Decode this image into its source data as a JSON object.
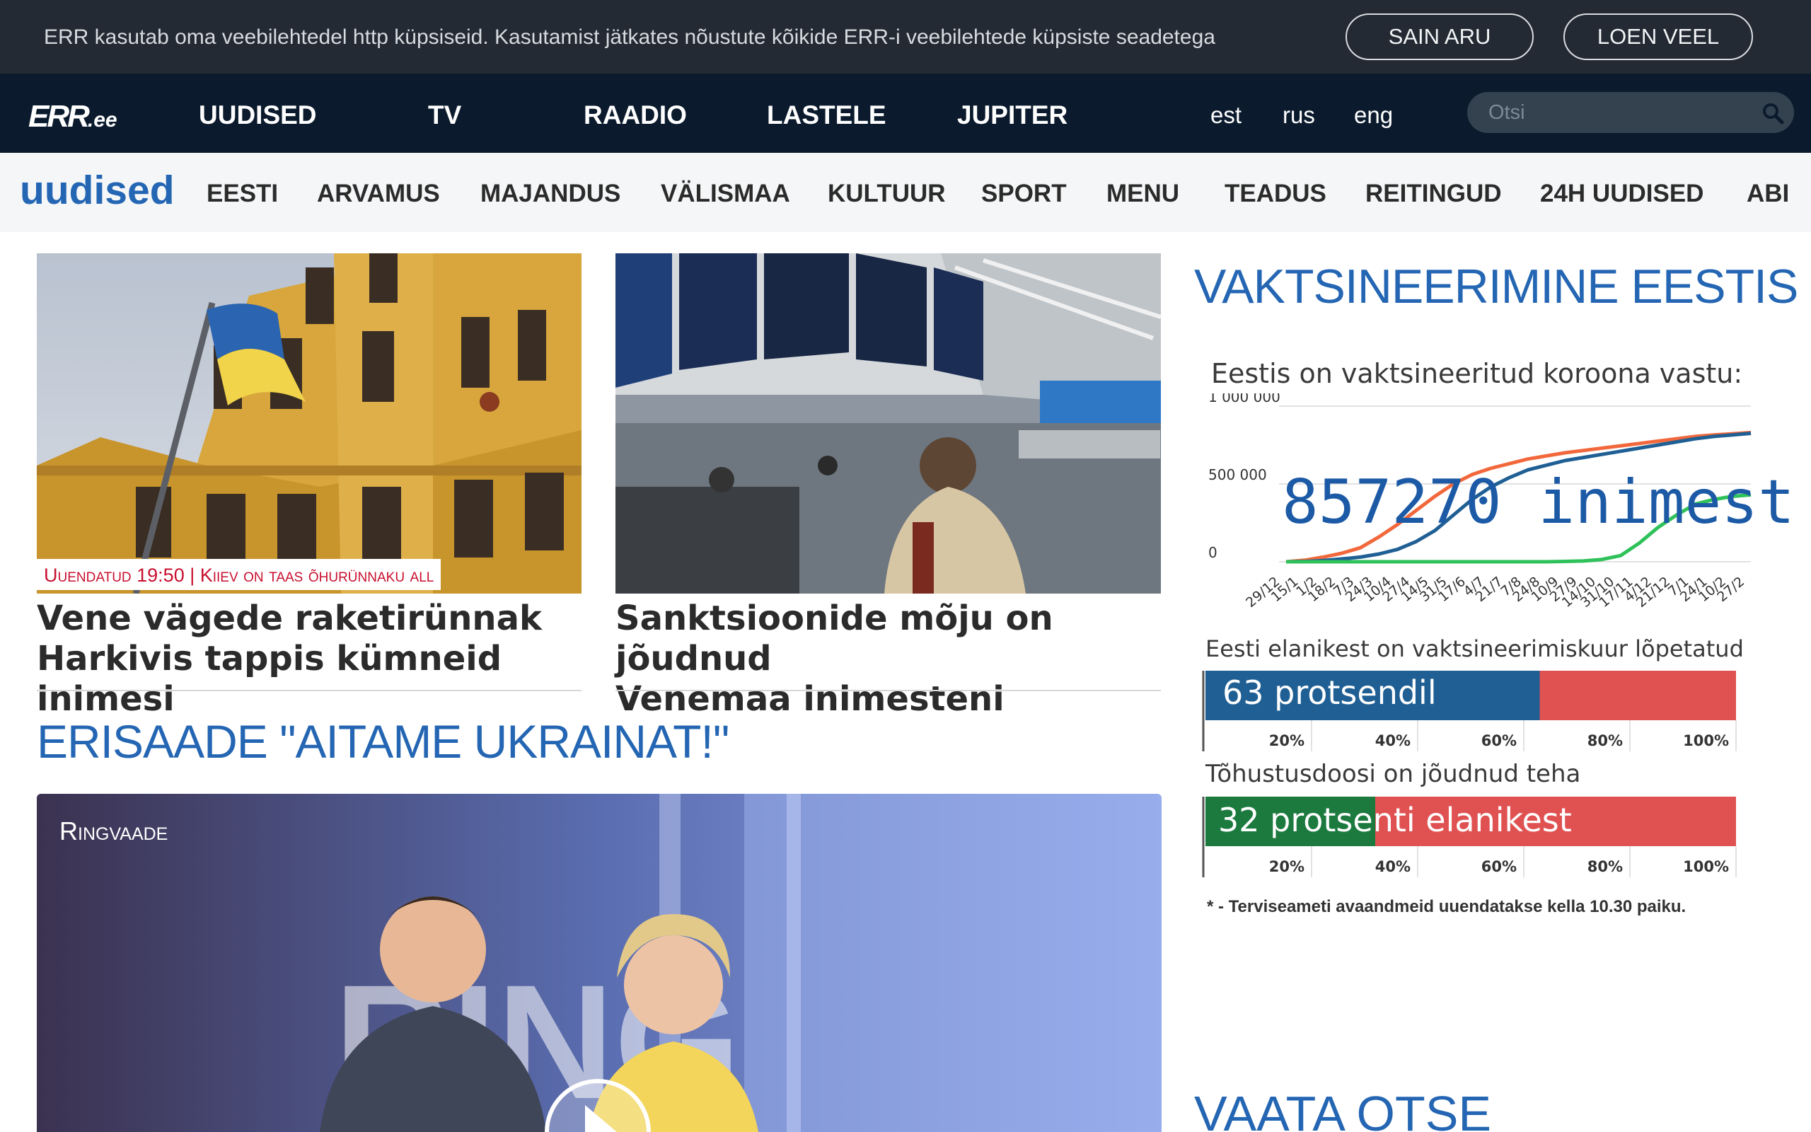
{
  "cookie_bar": {
    "message": "ERR kasutab oma veebilehtedel http küpsiseid. Kasutamist jätkates nõustute kõikide ERR-i veebilehtede küpsiste seadetega",
    "accept_label": "SAIN ARU",
    "more_label": "LOEN VEEL"
  },
  "main_nav": {
    "logo_main": "ERR",
    "logo_suffix": ".ee",
    "items": [
      "UUDISED",
      "TV",
      "RAADIO",
      "LASTELE",
      "JUPITER"
    ],
    "languages": [
      "est",
      "rus",
      "eng"
    ],
    "search_placeholder": "Otsi"
  },
  "section_nav": {
    "brand": "uudised",
    "items": [
      "EESTI",
      "ARVAMUS",
      "MAJANDUS",
      "VÄLISMAA",
      "KULTUUR",
      "SPORT",
      "MENU",
      "TEADUS",
      "REITINGUD",
      "24H UUDISED",
      "ABI"
    ]
  },
  "articles": [
    {
      "tag": "Uuendatud 19:50 | Kiiev on taas õhurünnaku all",
      "title_line1": "Vene vägede raketirünnak",
      "title_line2": "Harkivis tappis kümneid inimesi"
    },
    {
      "title_line1": "Sanktsioonide mõju on jõudnud",
      "title_line2": "Venemaa inimesteni"
    }
  ],
  "special": {
    "title": "ERISAADE \"AITAME UKRAINAT!\"",
    "video_label": "Ringvaade"
  },
  "vaccination": {
    "title": "VAKTSINEERIMINE EESTIS",
    "subtitle": "Eestis on vaktsineeritud koroona vastu:",
    "total_label": "857270 inimest",
    "completed_label": "Eesti elanikest on vaktsineerimiskuur lõpetatud",
    "completed_bar_text": "63 protsendil",
    "booster_label": "Tõhustusdoosi on jõudnud teha",
    "booster_bar_text": "32 protsenti elanikest",
    "note": "* - Terviseameti avaandmeid uuendatakse kella 10.30 paiku."
  },
  "live": {
    "title": "VAATA OTSE"
  },
  "colors": {
    "accent_blue": "#2466b3",
    "nav_dark": "#0b1b2d",
    "bar_blue": "#1f5f94",
    "bar_red": "#e05252",
    "bar_green": "#1c7a3f",
    "series_orange": "#f2683c",
    "series_blue": "#1f5f94",
    "series_green": "#2fc15a"
  },
  "chart_data": [
    {
      "type": "line",
      "title": "Eestis on vaktsineeritud koroona vastu:",
      "x": [
        "29/12",
        "15/1",
        "1/2",
        "18/2",
        "7/3",
        "24/3",
        "10/4",
        "27/4",
        "14/5",
        "31/5",
        "17/6",
        "4/7",
        "21/7",
        "7/8",
        "24/8",
        "10/9",
        "27/9",
        "14/10",
        "31/10",
        "17/11",
        "4/12",
        "21/12",
        "7/1",
        "24/1",
        "10/2",
        "27/2"
      ],
      "ylim": [
        0,
        1000000
      ],
      "yticks": [
        "1 000 000",
        "500 000",
        "0"
      ],
      "series": [
        {
          "color": "#f2683c",
          "values": [
            0,
            10000,
            30000,
            55000,
            90000,
            160000,
            240000,
            330000,
            420000,
            500000,
            560000,
            600000,
            630000,
            660000,
            680000,
            700000,
            715000,
            730000,
            745000,
            760000,
            775000,
            790000,
            805000,
            815000,
            822000,
            830000
          ]
        },
        {
          "color": "#1f5f94",
          "values": [
            0,
            2000,
            8000,
            18000,
            30000,
            50000,
            80000,
            130000,
            200000,
            300000,
            400000,
            480000,
            540000,
            590000,
            620000,
            650000,
            670000,
            690000,
            710000,
            730000,
            750000,
            770000,
            790000,
            805000,
            815000,
            825000
          ]
        },
        {
          "color": "#2fc15a",
          "values": [
            0,
            0,
            0,
            0,
            0,
            0,
            0,
            0,
            0,
            0,
            0,
            0,
            0,
            0,
            0,
            2000,
            5000,
            15000,
            40000,
            120000,
            220000,
            300000,
            370000,
            400000,
            420000,
            430000
          ]
        }
      ]
    },
    {
      "type": "bar",
      "title": "Eesti elanikest on vaktsineerimiskuur lõpetatud",
      "values": [
        63
      ],
      "xticks": [
        "20%",
        "40%",
        "60%",
        "80%",
        "100%"
      ],
      "xlim": [
        0,
        100
      ]
    },
    {
      "type": "bar",
      "title": "Tõhustusdoosi on jõudnud teha",
      "values": [
        32
      ],
      "xticks": [
        "20%",
        "40%",
        "60%",
        "80%",
        "100%"
      ],
      "xlim": [
        0,
        100
      ]
    }
  ]
}
